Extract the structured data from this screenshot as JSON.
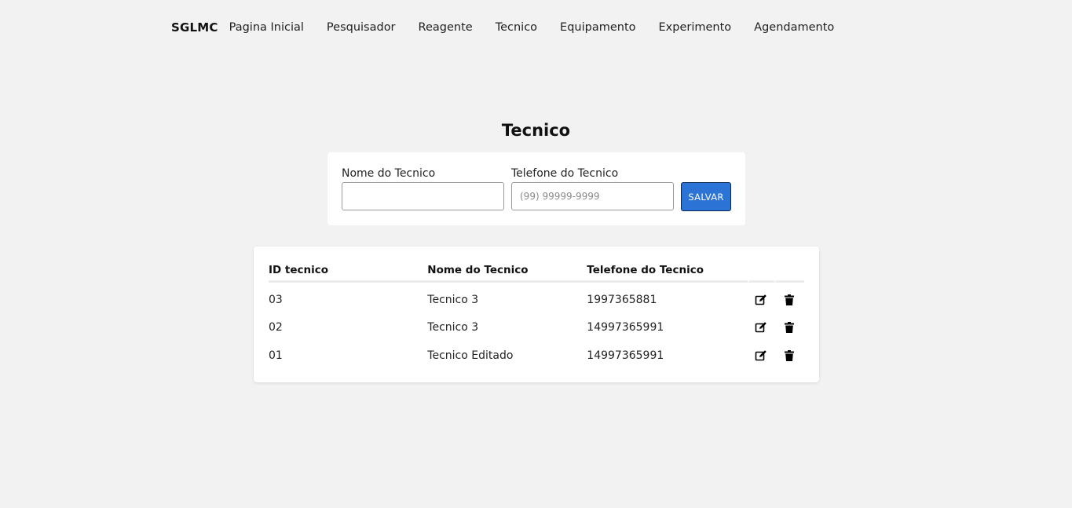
{
  "nav": {
    "brand": "SGLMC",
    "links": [
      "Pagina Inicial",
      "Pesquisador",
      "Reagente",
      "Tecnico",
      "Equipamento",
      "Experimento",
      "Agendamento"
    ]
  },
  "page": {
    "title": "Tecnico"
  },
  "form": {
    "name_label": "Nome do Tecnico",
    "name_value": "",
    "phone_label": "Telefone do Tecnico",
    "phone_placeholder": "(99) 99999-9999",
    "save_label": "SALVAR"
  },
  "table": {
    "headers": [
      "ID tecnico",
      "Nome do Tecnico",
      "Telefone do Tecnico"
    ],
    "rows": [
      {
        "id": "03",
        "name": "Tecnico 3",
        "phone": "1997365881"
      },
      {
        "id": "02",
        "name": "Tecnico 3",
        "phone": "14997365991"
      },
      {
        "id": "01",
        "name": "Tecnico Editado",
        "phone": "14997365991"
      }
    ],
    "row_icons": [
      "edit-icon",
      "trash-icon"
    ]
  },
  "colors": {
    "background": "#f2f2f2",
    "card": "#ffffff",
    "primary_button": "#2b74d6"
  }
}
